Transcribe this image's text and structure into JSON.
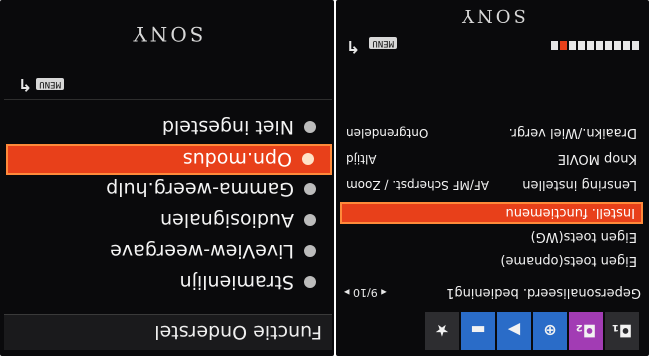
{
  "left_screen": {
    "title": "Functie Onderstel",
    "items": [
      {
        "label": "Stramienlijn"
      },
      {
        "label": "LiveView-weergave"
      },
      {
        "label": "Audiosignalen"
      },
      {
        "label": "Gamma-weerg.hulp"
      },
      {
        "label": "Opn.modus"
      },
      {
        "label": "Niet ingesteld"
      }
    ],
    "selected_index": 4,
    "menu_badge": "MENU",
    "return_icon": "return-arrow-icon",
    "brand": "SONY"
  },
  "right_screen": {
    "tabs": [
      {
        "icon": "star-icon",
        "glyph": "★"
      },
      {
        "icon": "playback-toolbox-icon",
        "glyph": "▬"
      },
      {
        "icon": "playback-icon",
        "glyph": "▶"
      },
      {
        "icon": "network-globe-icon",
        "glyph": "⊕"
      },
      {
        "icon": "custom-camera-2-icon",
        "glyph": "₂"
      },
      {
        "icon": "custom-camera-1-icon",
        "glyph": "₁"
      }
    ],
    "header": {
      "title": "Gepersonaliseerd. bediening1",
      "page": "9/10"
    },
    "items": [
      {
        "label": "Eigen toets(opname)"
      },
      {
        "label": "Eigen toets(WG)"
      },
      {
        "label": "Instell. functiemenu"
      },
      {
        "label": "Lensring instellen",
        "value": "AF/MF Scherpst. / Zoom"
      },
      {
        "label": "Knop MOVIE",
        "value": "Altijd"
      },
      {
        "label": "Draaikn./Wiel vergr.",
        "value": "Ontgrendelen"
      }
    ],
    "selected_index": 2,
    "page_indicator": {
      "total": 10,
      "current": 9
    },
    "menu_badge": "MENU",
    "return_icon": "return-arrow-icon",
    "brand": "SONY"
  },
  "colors": {
    "highlight": "#e8401a",
    "screen": "#0a0a0c",
    "text": "#f2f2f2"
  }
}
